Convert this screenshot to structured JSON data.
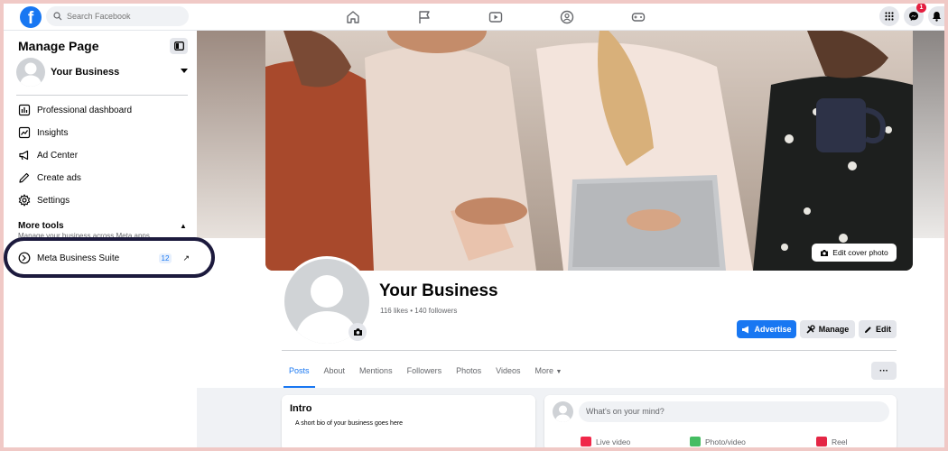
{
  "topbar": {
    "logo": "f",
    "search_placeholder": "Search Facebook",
    "notification_count": "1",
    "nav_icons": [
      "home-icon",
      "flag-icon",
      "video-icon",
      "groups-icon",
      "gaming-icon"
    ],
    "right_icons": [
      "menu-grid-icon",
      "messenger-icon",
      "bell-icon"
    ]
  },
  "sidebar": {
    "title": "Manage Page",
    "business_name": "Your Business",
    "items": [
      {
        "label": "Professional dashboard",
        "icon": "dashboard-icon"
      },
      {
        "label": "Insights",
        "icon": "insights-icon"
      },
      {
        "label": "Ad Center",
        "icon": "megaphone-icon"
      },
      {
        "label": "Create ads",
        "icon": "pencil-icon"
      },
      {
        "label": "Settings",
        "icon": "gear-icon"
      }
    ],
    "more_tools": {
      "label": "More tools",
      "subtitle": "Manage your business across Meta apps"
    },
    "meta_business_suite": {
      "label": "Meta Business Suite",
      "count": "12"
    }
  },
  "cover": {
    "edit_label": "Edit cover photo"
  },
  "profile": {
    "name": "Your Business",
    "stats": "116 likes • 140 followers",
    "buttons": {
      "advertise": "Advertise",
      "manage": "Manage",
      "edit": "Edit"
    }
  },
  "tabs": {
    "items": [
      "Posts",
      "About",
      "Mentions",
      "Followers",
      "Photos",
      "Videos",
      "More"
    ],
    "more_menu": "···"
  },
  "intro": {
    "title": "Intro",
    "text": "A short bio of your business goes here"
  },
  "composer": {
    "placeholder": "What's on your mind?",
    "actions": [
      {
        "label": "Live video",
        "color": "#f02849"
      },
      {
        "label": "Photo/video",
        "color": "#45bd62"
      },
      {
        "label": "Reel",
        "color": "#e42645"
      }
    ]
  },
  "colors": {
    "accent": "#1877f2",
    "highlight_oval": "#1c1a3d",
    "frame": "#f0c9c6"
  }
}
